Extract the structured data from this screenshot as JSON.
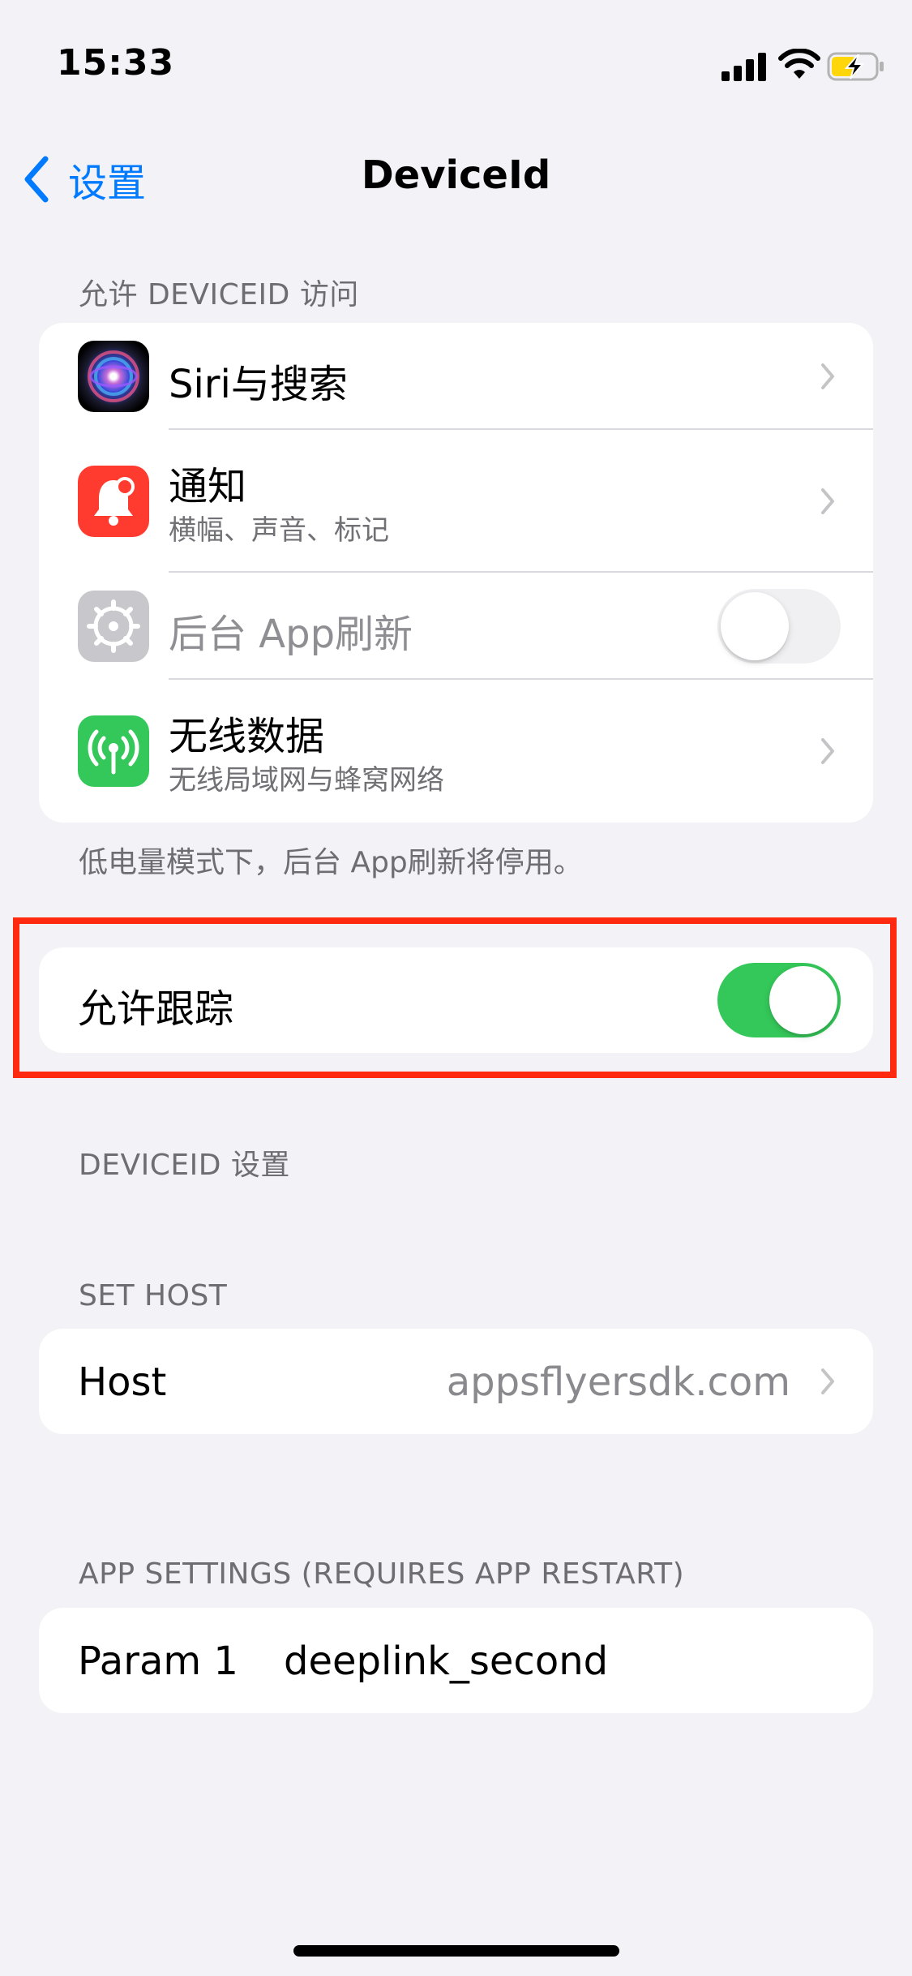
{
  "status_bar": {
    "time": "15:33"
  },
  "nav": {
    "back_label": "设置",
    "title": "DeviceId"
  },
  "access_section": {
    "header": "允许 DEVICEID 访问",
    "items": [
      {
        "title": "Siri与搜索",
        "icon": "siri-icon"
      },
      {
        "title": "通知",
        "subtitle": "横幅、声音、标记",
        "icon": "bell-icon",
        "color": "#ff3b30"
      },
      {
        "title": "后台 App刷新",
        "icon": "gear-icon",
        "enabled": false,
        "toggle_on": false
      },
      {
        "title": "无线数据",
        "subtitle": "无线局域网与蜂窝网络",
        "icon": "antenna-icon",
        "color": "#34c759"
      }
    ],
    "footer": "低电量模式下，后台 App刷新将停用。"
  },
  "tracking": {
    "label": "允许跟踪",
    "toggle_on": true,
    "highlight_color": "#ff2a0f"
  },
  "deviceid_settings": {
    "header": "DEVICEID 设置"
  },
  "set_host": {
    "header": "SET HOST",
    "host_label": "Host",
    "host_value": "appsflyersdk.com"
  },
  "app_settings": {
    "header": "APP SETTINGS (REQUIRES APP RESTART)",
    "param_label": "Param 1",
    "param_value": "deeplink_second"
  },
  "colors": {
    "accent": "#007aff",
    "toggle_on": "#34c759",
    "toggle_off": "#e9e9eb"
  }
}
